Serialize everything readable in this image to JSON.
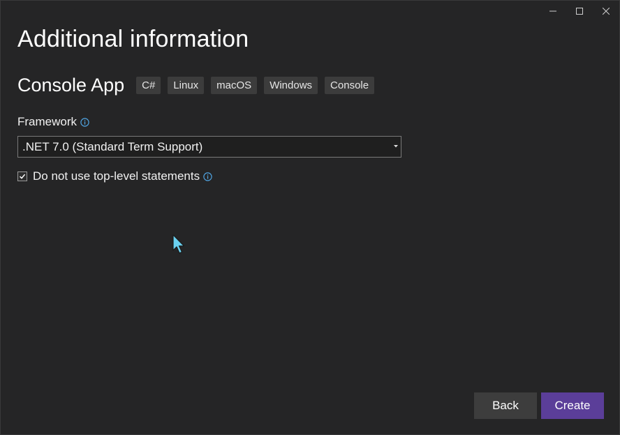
{
  "window": {
    "title": "Additional information"
  },
  "app": {
    "name": "Console App",
    "tags": [
      "C#",
      "Linux",
      "macOS",
      "Windows",
      "Console"
    ]
  },
  "framework": {
    "label": "Framework",
    "selected": ".NET 7.0 (Standard Term Support)"
  },
  "options": {
    "top_level_label": "Do not use top-level statements",
    "top_level_checked": true
  },
  "buttons": {
    "back": "Back",
    "create": "Create"
  },
  "colors": {
    "accent": "#5b3e99",
    "info": "#4fa3e0",
    "cursor": "#6ad1f0"
  },
  "icons": [
    "minimize-icon",
    "maximize-icon",
    "close-icon",
    "info-icon",
    "chevron-down-icon",
    "checkmark-icon",
    "mouse-cursor-icon"
  ]
}
